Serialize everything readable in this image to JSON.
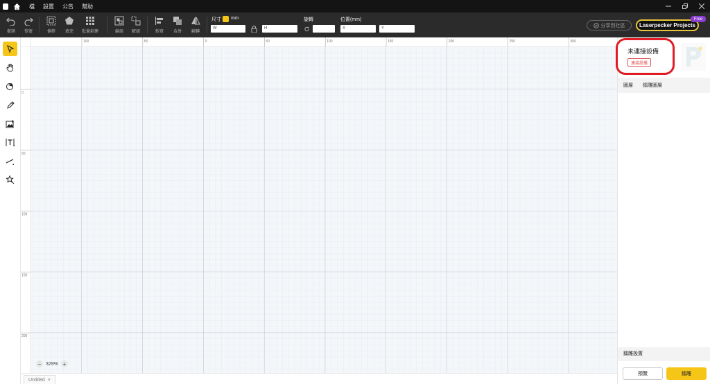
{
  "menubar": {
    "items": [
      "檔",
      "設置",
      "公告",
      "幫助"
    ]
  },
  "toolbar": {
    "undo_label": "撤銷",
    "redo_label": "恢復",
    "offset_label": "偏移",
    "fill_label": "填充",
    "batch_label": "批量創建",
    "group_label": "編組",
    "ungroup_label": "解組",
    "align_label": "對齊",
    "merge_label": "合併",
    "flip_label": "翻轉",
    "size_label": "尺寸",
    "size_unit": "mm",
    "w_label": "W",
    "h_label": "H",
    "rotate_label": "旋轉",
    "position_label": "位置(mm)",
    "x_label": "X",
    "y_label": "Y",
    "share_label": "分享到社區",
    "projects_label": "Laserpecker Projects",
    "free_badge": "Free"
  },
  "ruler": {
    "top": [
      "100",
      "50",
      "0",
      "50",
      "100",
      "150",
      "200",
      "250",
      "300"
    ],
    "left": [
      "0",
      "50",
      "100",
      "150",
      "200"
    ]
  },
  "canvas": {
    "zoom": "329%",
    "zoom_minus": "−",
    "zoom_plus": "+"
  },
  "tabs": [
    {
      "label": "Untitled",
      "close": "×"
    }
  ],
  "panel": {
    "device_status": "未連接設備",
    "connect_label": "連接設備",
    "tab_layers": "圖層",
    "tab_burn_layers": "鐳雕圖層",
    "burn_settings": "鐳雕設置",
    "preview_label": "預覽",
    "burn_label": "鐳雕"
  },
  "colors": {
    "accent": "#f5c518",
    "menubar_bg": "#141414",
    "toolbar_bg": "#2b2b2b",
    "highlight_circle": "#e01b24"
  }
}
